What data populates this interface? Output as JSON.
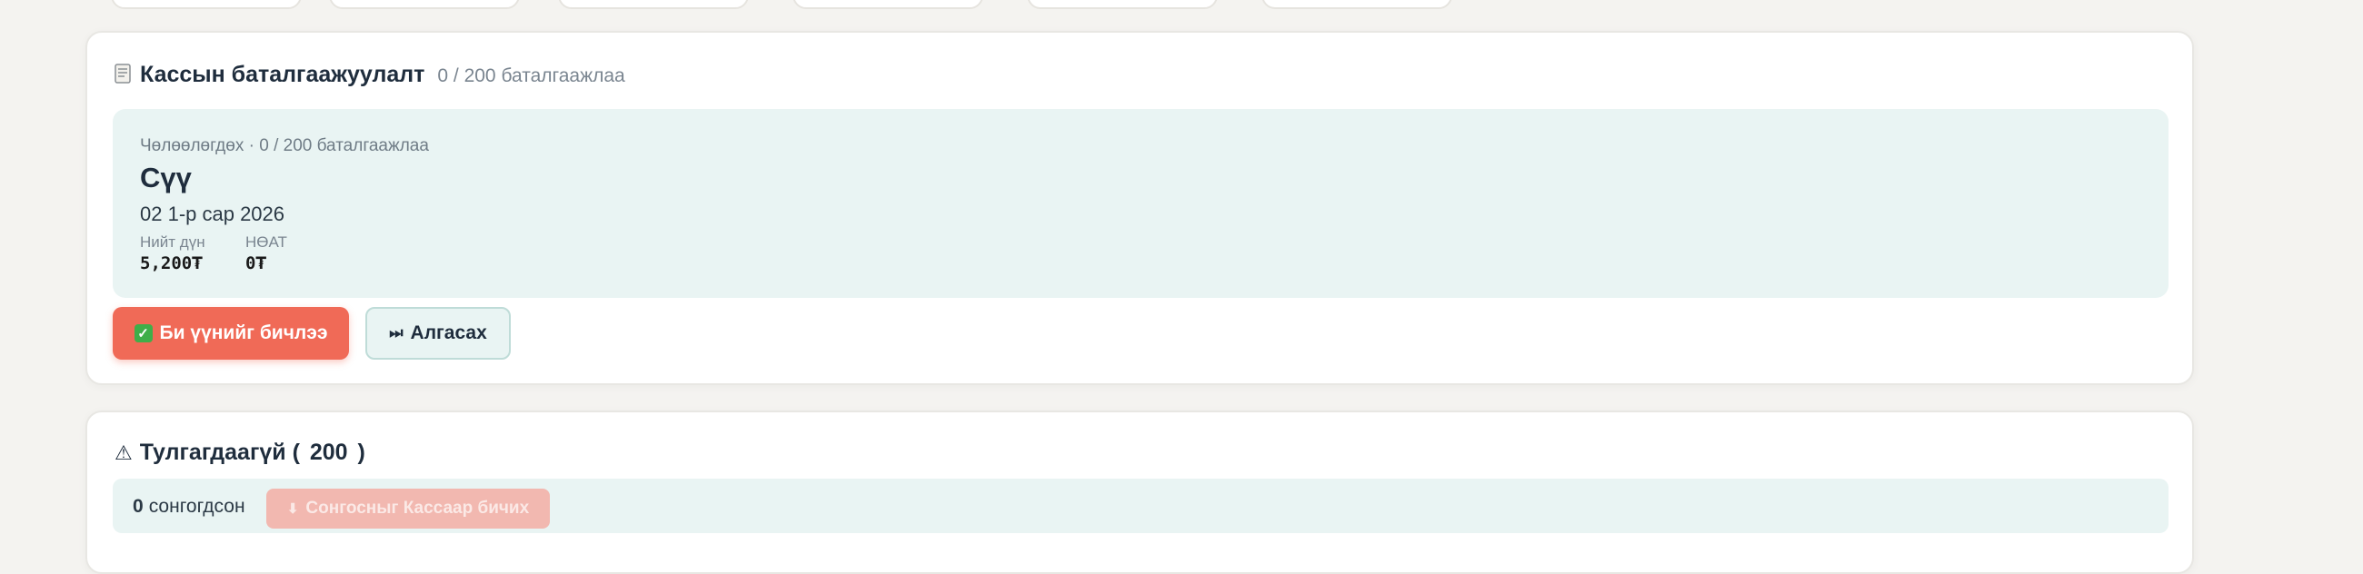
{
  "verification": {
    "title": "Кассын баталгаажуулалт",
    "progress": "0 / 200 баталгаажлаа",
    "status_line": "Чөлөөлөгдөх · 0 / 200 баталгаажлаа",
    "item_name": "Сүү",
    "item_date": "02 1-р сар 2026",
    "total_label": "Нийт дүн",
    "total_value": "5,200₮",
    "vat_label": "НӨАТ",
    "vat_value": "0₮",
    "confirm_button": "Би үүнийг бичлээ",
    "skip_button": "Алгасах"
  },
  "unpaid": {
    "title_prefix": "Тулгагдаагүй (",
    "count": "200",
    "title_suffix": ")",
    "selected_count": "0",
    "selected_label": "сонгогдсон",
    "write_selected_button": "Сонгосныг Кассаар бичих"
  },
  "colors": {
    "primary": "#f06a57",
    "panel": "#e9f4f3",
    "success": "#3fae49"
  },
  "icons": {
    "receipt": "receipt-icon",
    "check": "check-icon",
    "skip": "skip-forward-icon",
    "warning": "warning-icon",
    "download": "download-icon"
  }
}
